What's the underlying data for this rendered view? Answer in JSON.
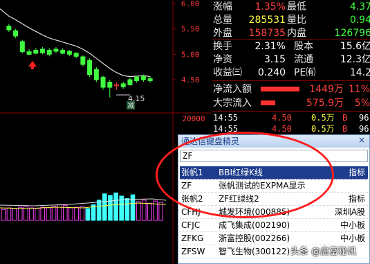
{
  "chart": {
    "price_ticks": [
      "6.00",
      "5.50",
      "5.00",
      "4.50"
    ],
    "volume_tick": "20000",
    "annotation_low": "4.15",
    "annotation_reduce": "减",
    "colors": {
      "up": "#ff4040",
      "down": "#40ff40",
      "ma": "#e0e0e0",
      "cyan_vol": "#40ffff",
      "magenta_vol": "#ff40ff"
    },
    "candles": [
      {
        "o": 5.55,
        "c": 5.48,
        "h": 5.6,
        "l": 5.44
      },
      {
        "o": 5.46,
        "c": 5.36,
        "h": 5.5,
        "l": 5.32
      },
      {
        "o": 5.25,
        "c": 5.05,
        "h": 5.28,
        "l": 5.02
      },
      {
        "o": 5.05,
        "c": 5.0,
        "h": 5.1,
        "l": 4.98
      },
      {
        "o": 5.08,
        "c": 5.02,
        "h": 5.12,
        "l": 5.0
      },
      {
        "o": 5.1,
        "c": 5.03,
        "h": 5.14,
        "l": 5.0
      },
      {
        "o": 5.08,
        "c": 5.0,
        "h": 5.12,
        "l": 4.96
      },
      {
        "o": 5.1,
        "c": 5.06,
        "h": 5.14,
        "l": 5.02
      },
      {
        "o": 5.08,
        "c": 5.02,
        "h": 5.12,
        "l": 5.0
      },
      {
        "o": 5.06,
        "c": 5.0,
        "h": 5.08,
        "l": 4.96
      },
      {
        "o": 5.02,
        "c": 4.96,
        "h": 5.04,
        "l": 4.92
      },
      {
        "o": 4.95,
        "c": 4.8,
        "h": 4.98,
        "l": 4.76
      },
      {
        "o": 4.88,
        "c": 4.6,
        "h": 4.92,
        "l": 4.55
      },
      {
        "o": 4.7,
        "c": 4.5,
        "h": 4.75,
        "l": 4.45
      },
      {
        "o": 4.55,
        "c": 4.35,
        "h": 4.58,
        "l": 4.3
      },
      {
        "o": 4.45,
        "c": 4.35,
        "h": 4.5,
        "l": 4.15
      },
      {
        "o": 4.38,
        "c": 4.4,
        "h": 4.44,
        "l": 4.3
      },
      {
        "o": 4.42,
        "c": 4.36,
        "h": 4.46,
        "l": 4.32
      },
      {
        "o": 4.5,
        "c": 4.4,
        "h": 4.54,
        "l": 4.38
      },
      {
        "o": 4.55,
        "c": 4.48,
        "h": 4.58,
        "l": 4.44
      },
      {
        "o": 4.56,
        "c": 4.5,
        "h": 4.6,
        "l": 4.46
      },
      {
        "o": 4.52,
        "c": 4.48,
        "h": 4.56,
        "l": 4.44
      }
    ],
    "ma": [
      5.75,
      5.68,
      5.6,
      5.52,
      5.45,
      5.38,
      5.32,
      5.28,
      5.24,
      5.2,
      5.16,
      5.1,
      5.02,
      4.92,
      4.82,
      4.72,
      4.64,
      4.58,
      4.56,
      4.57,
      4.58,
      4.56
    ],
    "volumes": [
      {
        "v": 0.35,
        "c": "magenta"
      },
      {
        "v": 0.4,
        "c": "magenta"
      },
      {
        "v": 0.38,
        "c": "magenta"
      },
      {
        "v": 0.42,
        "c": "magenta"
      },
      {
        "v": 0.45,
        "c": "magenta"
      },
      {
        "v": 0.4,
        "c": "magenta"
      },
      {
        "v": 0.38,
        "c": "magenta"
      },
      {
        "v": 0.42,
        "c": "magenta"
      },
      {
        "v": 0.4,
        "c": "magenta"
      },
      {
        "v": 0.45,
        "c": "magenta"
      },
      {
        "v": 0.5,
        "c": "magenta"
      },
      {
        "v": 0.48,
        "c": "magenta"
      },
      {
        "v": 0.4,
        "c": "magenta"
      },
      {
        "v": 0.42,
        "c": "magenta"
      },
      {
        "v": 0.45,
        "c": "magenta"
      },
      {
        "v": 0.38,
        "c": "cyan"
      },
      {
        "v": 0.5,
        "c": "cyan"
      },
      {
        "v": 0.65,
        "c": "cyan"
      },
      {
        "v": 0.85,
        "c": "cyan"
      },
      {
        "v": 0.8,
        "c": "cyan"
      },
      {
        "v": 0.88,
        "c": "cyan"
      },
      {
        "v": 0.78,
        "c": "cyan"
      },
      {
        "v": 0.7,
        "c": "cyan"
      },
      {
        "v": 0.82,
        "c": "cyan"
      },
      {
        "v": 0.6,
        "c": "magenta"
      },
      {
        "v": 0.65,
        "c": "magenta"
      },
      {
        "v": 0.55,
        "c": "magenta"
      },
      {
        "v": 0.62,
        "c": "magenta"
      },
      {
        "v": 0.58,
        "c": "magenta"
      }
    ]
  },
  "quote": {
    "rows": [
      {
        "l1": "涨幅",
        "v1": "1.35%",
        "c1": "red",
        "l2": "最低",
        "v2": "4.37",
        "c2": "green"
      },
      {
        "l1": "总量",
        "v1": "285531",
        "c1": "yellow",
        "l2": "量比",
        "v2": "0.94",
        "c2": "green"
      },
      {
        "l1": "外盘",
        "v1": "158735",
        "c1": "red",
        "l2": "内盘",
        "v2": "126796",
        "c2": "green"
      },
      {
        "l1": "换手",
        "v1": "2.31%",
        "c1": "white",
        "l2": "股本",
        "v2": "15.6亿",
        "c2": "white"
      },
      {
        "l1": "净资",
        "v1": "3.15",
        "c1": "white",
        "l2": "流通",
        "v2": "12.3亿",
        "c2": "white"
      },
      {
        "l1": "收益㈢",
        "v1": "0.240",
        "c1": "white",
        "l2": "PE㈲",
        "v2": "14.2",
        "c2": "white"
      }
    ],
    "flow": [
      {
        "label": "净流入额",
        "bar": 0.8,
        "value": "1449万",
        "pct": "11%"
      },
      {
        "label": "大宗流入",
        "bar": 0.3,
        "value": "575.9万",
        "pct": "5%"
      }
    ],
    "trades": [
      {
        "time": "14:55",
        "price": "4.50",
        "vol": "0.5万",
        "side": "B",
        "num": "96"
      },
      {
        "time": "14:55",
        "price": "4.50",
        "vol": "0.5万",
        "side": "B",
        "num": "96"
      }
    ]
  },
  "popup": {
    "title": "通达信键盘精灵",
    "close": "×",
    "input_value": "ZF",
    "items": [
      {
        "code": "张帆1",
        "name": "BBI红绿K线",
        "type": "指标",
        "selected": true
      },
      {
        "code": "ZF",
        "name": "张帆测试的EXPMA显示",
        "type": "",
        "selected": false
      },
      {
        "code": "张帆2",
        "name": "ZF红绿线2",
        "type": "指标",
        "selected": false
      },
      {
        "code": "CFHJ",
        "name": "城发环境(000885)",
        "type": "深圳A股",
        "selected": false
      },
      {
        "code": "CFJC",
        "name": "成飞集成(002190)",
        "type": "中小板",
        "selected": false
      },
      {
        "code": "ZFKG",
        "name": "浙富控股(002266)",
        "type": "中小板",
        "selected": false
      },
      {
        "code": "ZFSW",
        "name": "智飞生物(300122)",
        "type": "",
        "selected": false
      }
    ]
  },
  "watermark": "头条 @启富秘讯"
}
